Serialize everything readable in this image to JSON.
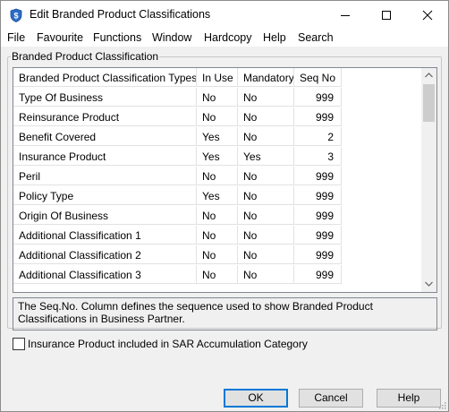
{
  "window": {
    "title": "Edit Branded Product Classifications"
  },
  "menu": [
    "File",
    "Favourite",
    "Functions",
    "Window",
    "Hardcopy",
    "Help",
    "Search"
  ],
  "group": {
    "label": "Branded Product Classification"
  },
  "grid": {
    "headers": [
      "Branded Product Classification Types",
      "In Use",
      "Mandatory",
      "Seq No"
    ],
    "rows": [
      [
        "Type Of Business",
        "No",
        "No",
        "999"
      ],
      [
        "Reinsurance Product",
        "No",
        "No",
        "999"
      ],
      [
        "Benefit Covered",
        "Yes",
        "No",
        "2"
      ],
      [
        "Insurance Product",
        "Yes",
        "Yes",
        "3"
      ],
      [
        "Peril",
        "No",
        "No",
        "999"
      ],
      [
        "Policy Type",
        "Yes",
        "No",
        "999"
      ],
      [
        "Origin Of Business",
        "No",
        "No",
        "999"
      ],
      [
        "Additional Classification 1",
        "No",
        "No",
        "999"
      ],
      [
        "Additional Classification 2",
        "No",
        "No",
        "999"
      ],
      [
        "Additional Classification 3",
        "No",
        "No",
        "999"
      ]
    ]
  },
  "info": "The Seq.No. Column defines the sequence used to show Branded Product Classifications in Business Partner.",
  "checkbox": {
    "label": "Insurance Product included in SAR Accumulation Category",
    "checked": false
  },
  "buttons": {
    "ok": "OK",
    "cancel": "Cancel",
    "help": "Help"
  },
  "icons": {
    "app": "app-shield-icon",
    "minimize": "minimize-icon",
    "maximize": "maximize-icon",
    "close": "close-icon",
    "scroll_up": "chevron-up-icon",
    "scroll_down": "chevron-down-icon"
  },
  "colors": {
    "default_button_border": "#0078d7",
    "app_icon": "#2b6cc4"
  }
}
